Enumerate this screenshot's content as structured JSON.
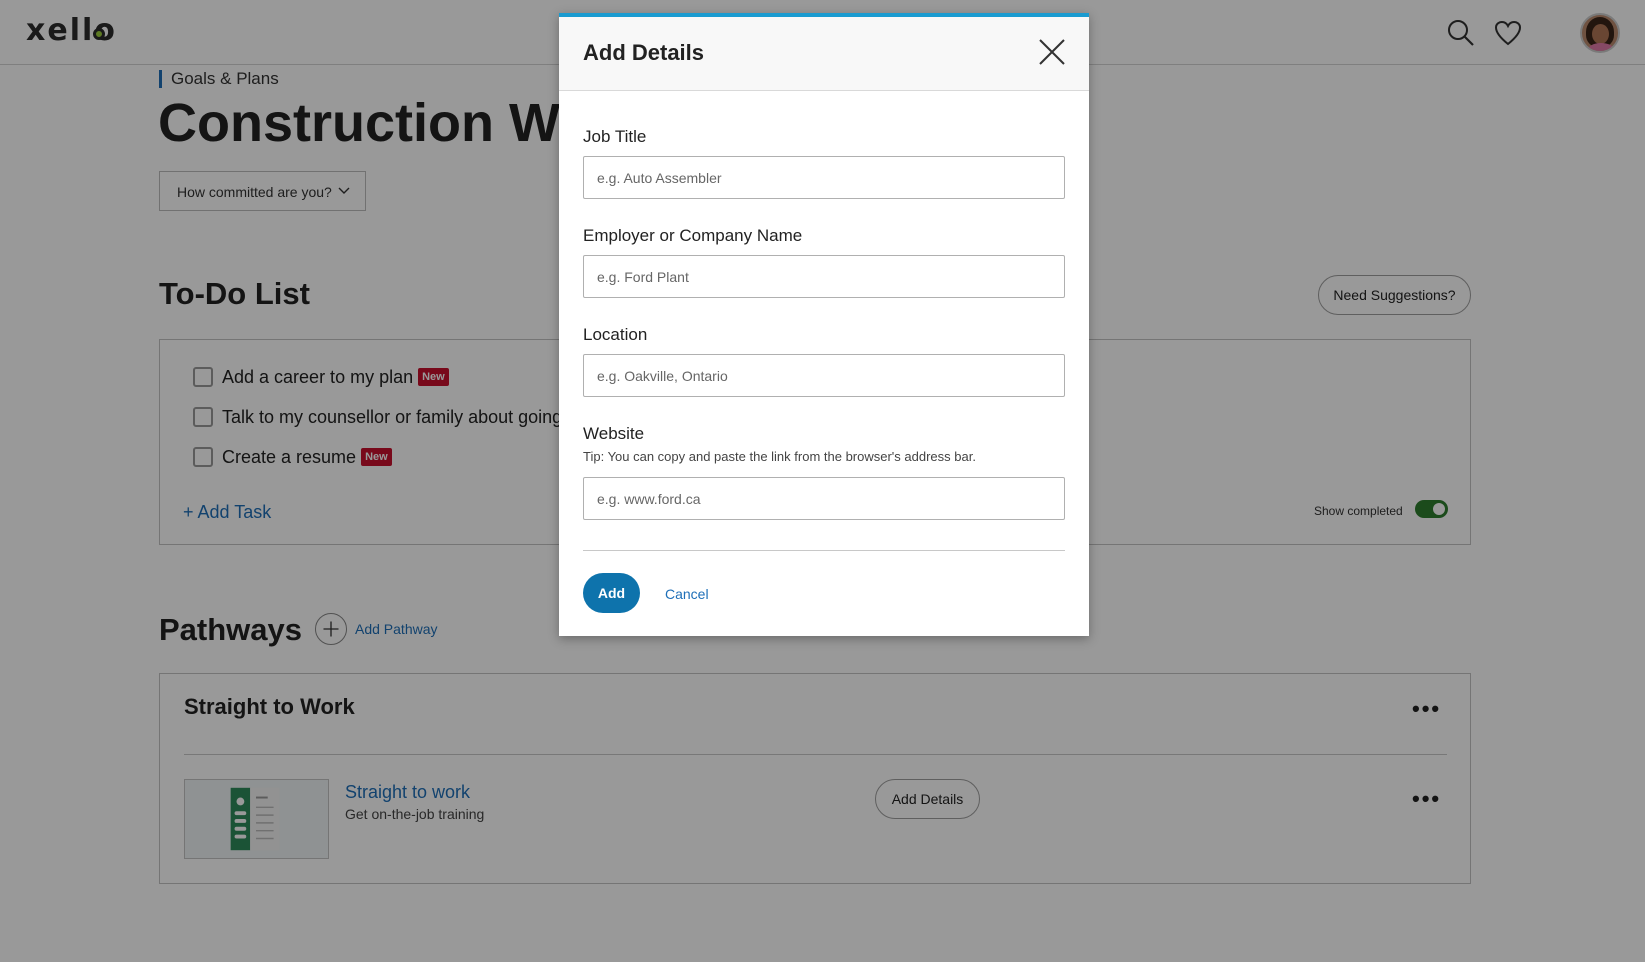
{
  "header": {
    "logo": "xello",
    "icons": [
      "search-icon",
      "heart-icon",
      "avatar"
    ]
  },
  "page": {
    "breadcrumb": "Goals & Plans",
    "title": "Construction Worker",
    "commitment_dropdown": "How committed are you?"
  },
  "todo": {
    "heading": "To-Do List",
    "suggestions_button": "Need Suggestions?",
    "items": [
      {
        "label": "Add a career to my plan",
        "badge": "New"
      },
      {
        "label": "Talk to my counsellor or family about going",
        "badge": ""
      },
      {
        "label": "Create a resume",
        "badge": "New"
      }
    ],
    "add_task": "Add Task",
    "show_completed_label": "Show completed",
    "show_completed": true
  },
  "pathways": {
    "heading": "Pathways",
    "add_pathway": "Add Pathway",
    "card": {
      "title": "Straight to Work",
      "item_name": "Straight to work",
      "item_sub": "Get on-the-job training",
      "add_details_button": "Add Details"
    }
  },
  "colors": {
    "modal_accent": "#1a9bd0",
    "primary_button": "#0e73ac",
    "link": "#1e6fb8",
    "new_badge": "#c8102e",
    "toggle_on": "#2d7d2d"
  },
  "modal": {
    "title": "Add Details",
    "fields": {
      "job_title": {
        "label": "Job Title",
        "placeholder": "e.g. Auto Assembler",
        "value": ""
      },
      "employer": {
        "label": "Employer or Company Name",
        "placeholder": "e.g. Ford Plant",
        "value": ""
      },
      "location": {
        "label": "Location",
        "placeholder": "e.g. Oakville, Ontario",
        "value": ""
      },
      "website": {
        "label": "Website",
        "tip": "Tip: You can copy and paste the link from the browser's address bar.",
        "placeholder": "e.g. www.ford.ca",
        "value": ""
      }
    },
    "add_button": "Add",
    "cancel_link": "Cancel"
  }
}
